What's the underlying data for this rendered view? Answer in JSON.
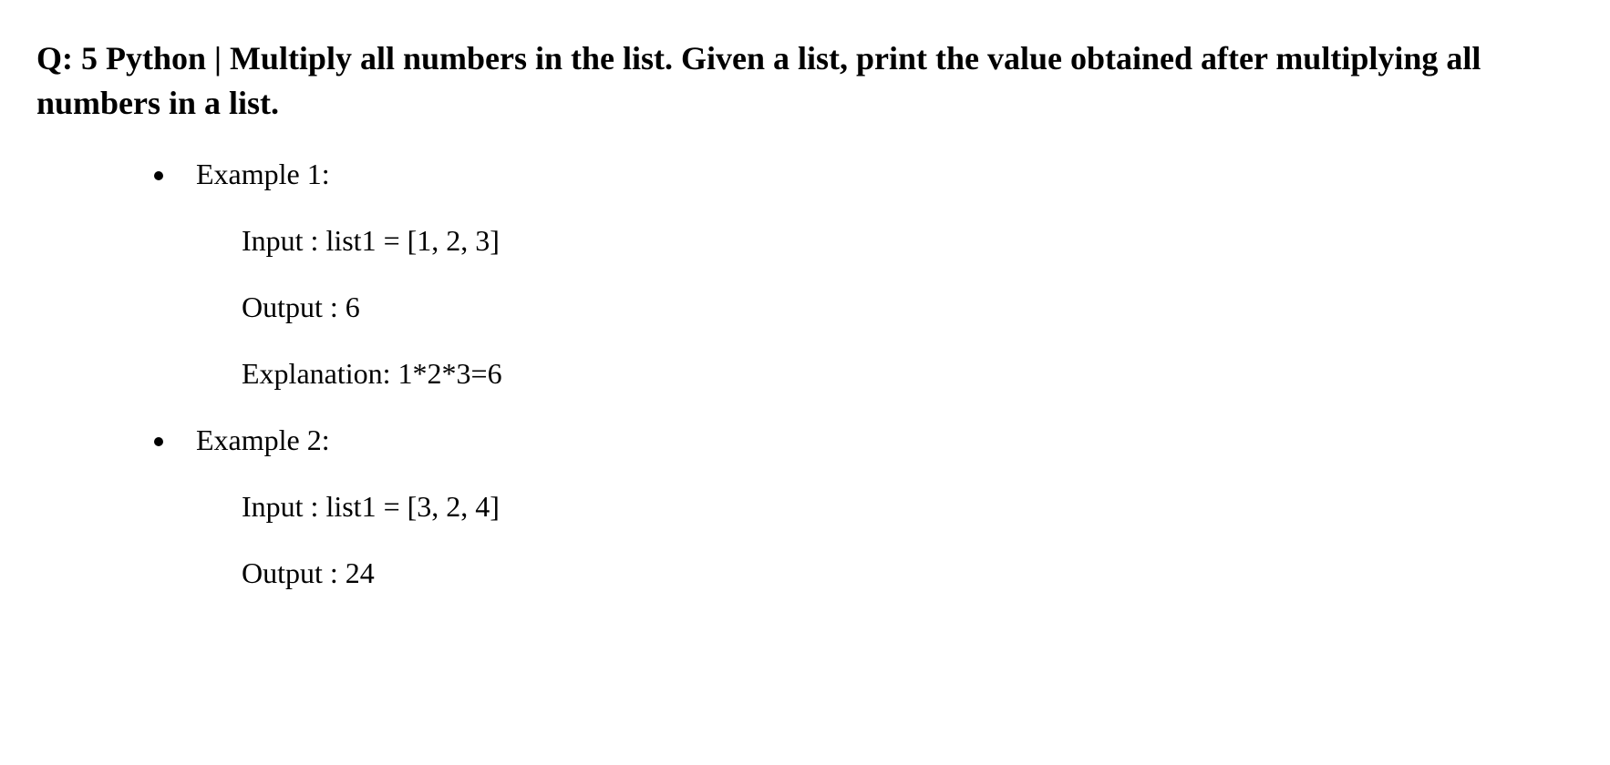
{
  "heading": "Q: 5 Python | Multiply all numbers in the list. Given a list, print the value obtained after multiplying all numbers in a list.",
  "examples": [
    {
      "label": "Example 1:",
      "lines": [
        "Input :  list1 = [1, 2, 3]",
        "Output : 6",
        "Explanation: 1*2*3=6"
      ]
    },
    {
      "label": "Example 2:",
      "lines": [
        "Input : list1 = [3, 2, 4]",
        "Output : 24"
      ]
    }
  ]
}
